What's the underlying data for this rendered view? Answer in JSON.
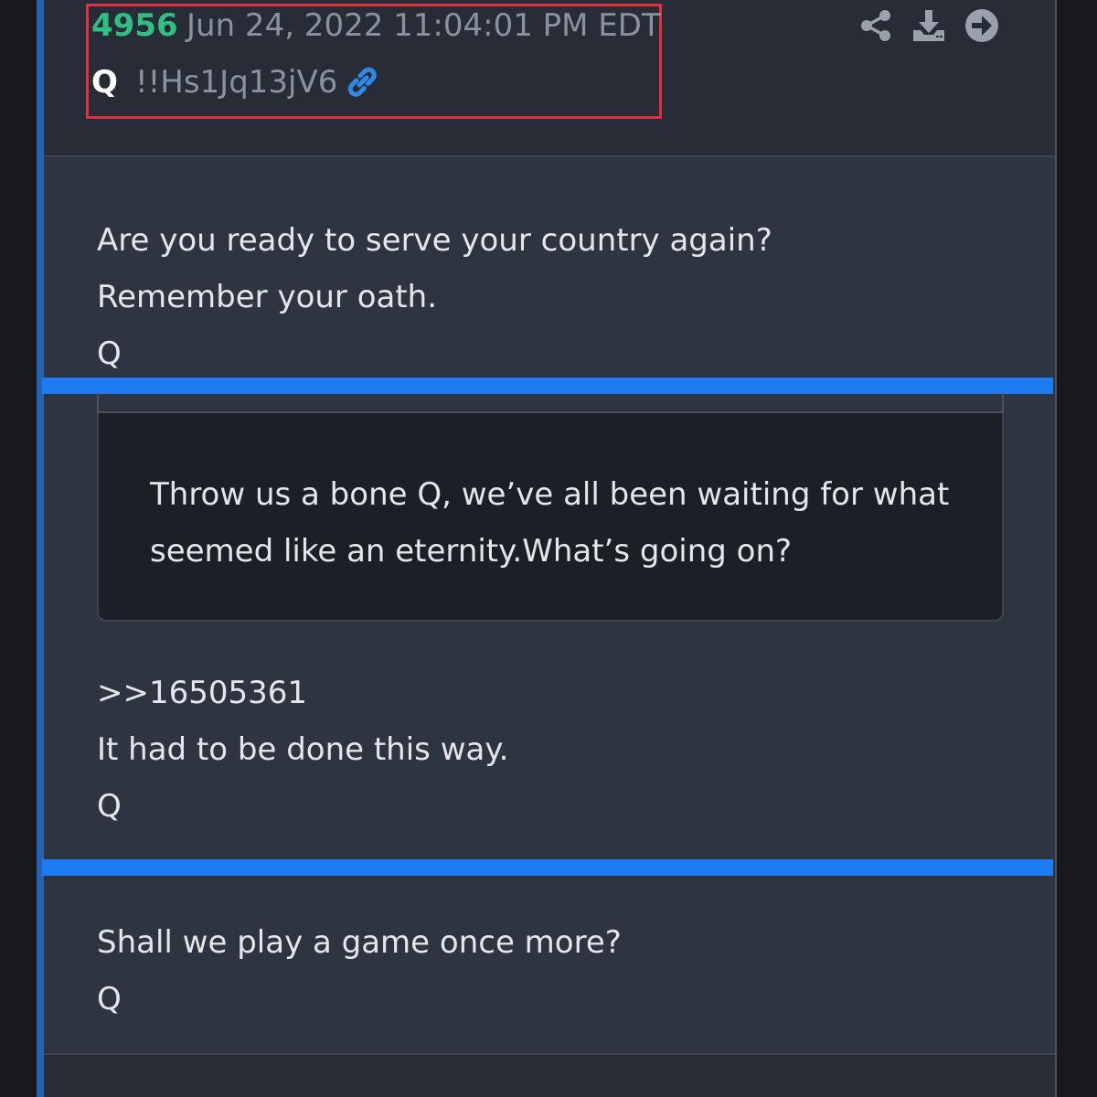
{
  "header": {
    "post_number": "4956",
    "date": "Jun 24, 2022 11:04:01 PM EDT",
    "author": "Q",
    "tripcode": "!!Hs1Jq13jV6",
    "highlight_color": "#e0323e",
    "icons": [
      "link-icon",
      "share-icon",
      "download-icon",
      "next-arrow-icon"
    ]
  },
  "posts": [
    {
      "lines": [
        "Are you ready to serve your country again?",
        "Remember your oath.",
        "Q"
      ]
    },
    {
      "quote_lines": [
        "Throw us a bone Q, we’ve all been waiting for what",
        "seemed like an eternity.What’s going on?"
      ],
      "lines": [
        ">>16505361",
        "It had to be done this way.",
        "Q"
      ]
    },
    {
      "lines": [
        "Shall we play a game once more?",
        "Q"
      ]
    }
  ],
  "colors": {
    "accent": "#1e7cf2",
    "post_number": "#2fbf83",
    "background": "#2e3540"
  }
}
